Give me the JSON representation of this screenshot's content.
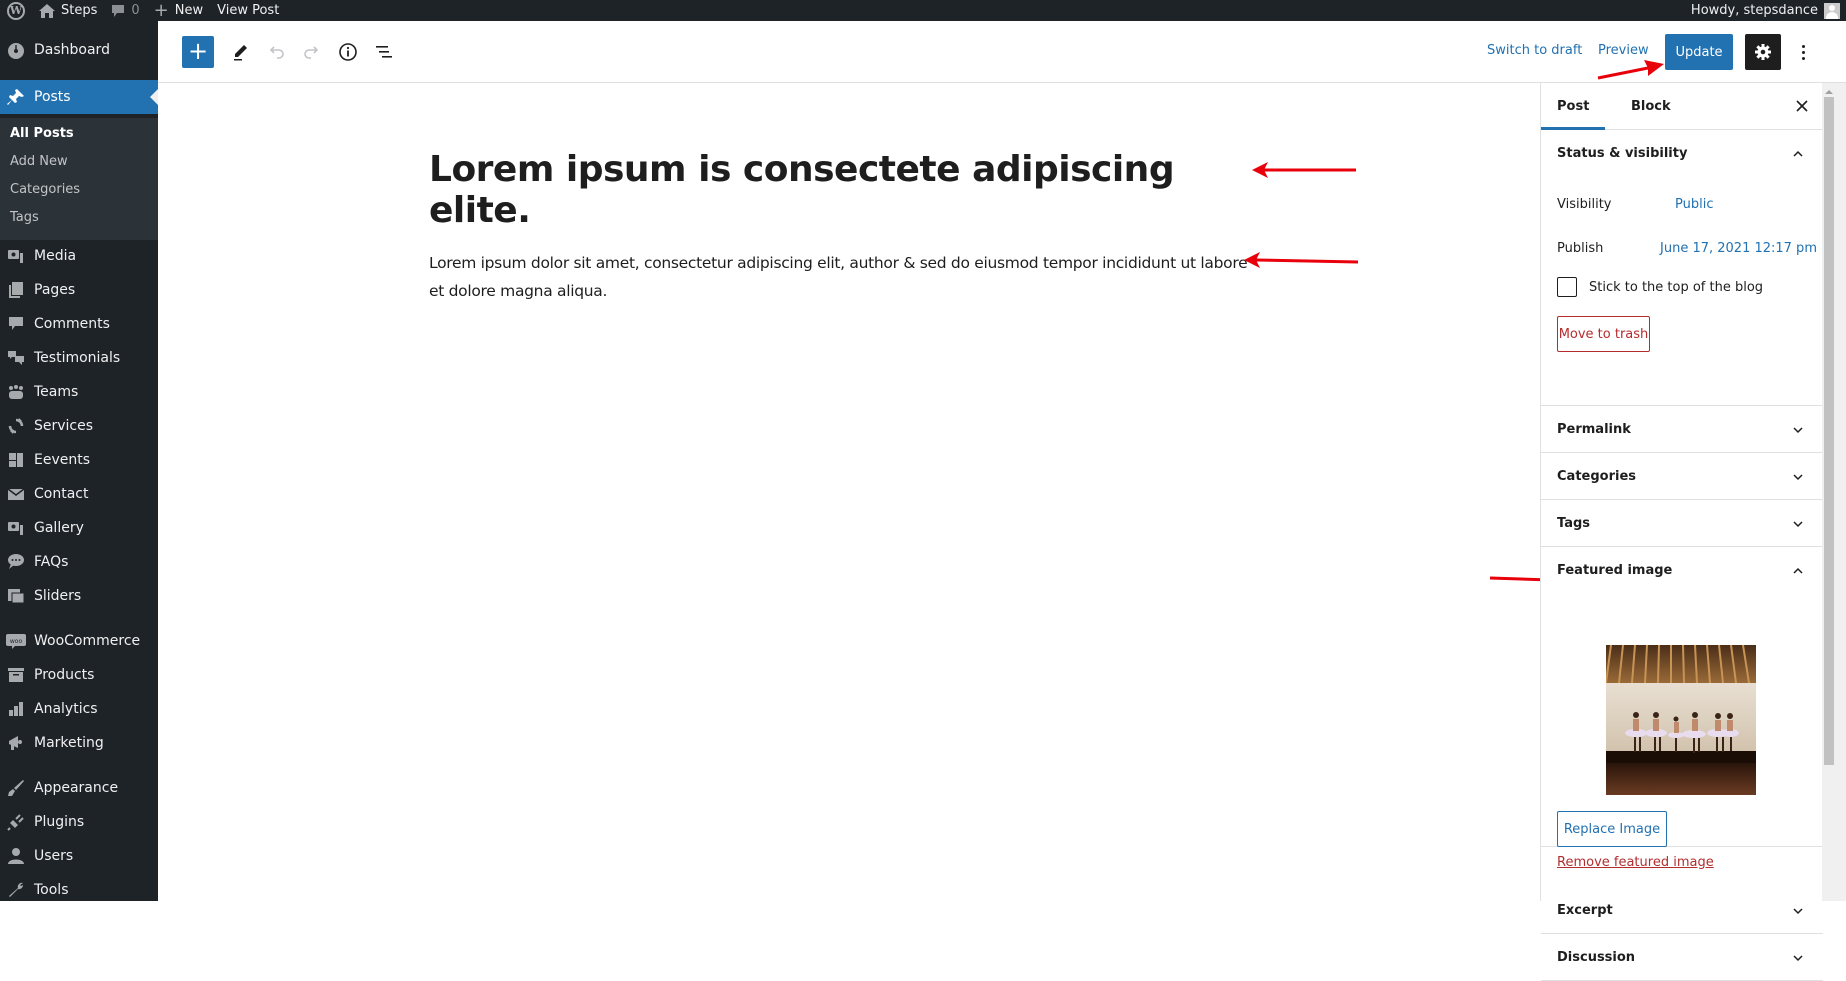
{
  "adminbar": {
    "site_name": "Steps",
    "comments_count": "0",
    "new_label": "New",
    "view_post_label": "View Post",
    "greeting": "Howdy, stepsdance"
  },
  "sidebar": {
    "items": [
      {
        "label": "Dashboard",
        "icon": "dashboard-icon"
      },
      {
        "label": "Posts",
        "icon": "pin-icon",
        "active": true
      },
      {
        "label": "Media",
        "icon": "media-icon"
      },
      {
        "label": "Pages",
        "icon": "pages-icon"
      },
      {
        "label": "Comments",
        "icon": "comment-icon"
      },
      {
        "label": "Testimonials",
        "icon": "testimonial-icon"
      },
      {
        "label": "Teams",
        "icon": "groups-icon"
      },
      {
        "label": "Services",
        "icon": "update-icon"
      },
      {
        "label": "Eevents",
        "icon": "layout-icon"
      },
      {
        "label": "Contact",
        "icon": "email-icon"
      },
      {
        "label": "Gallery",
        "icon": "media-icon"
      },
      {
        "label": "FAQs",
        "icon": "format-chat-icon"
      },
      {
        "label": "Sliders",
        "icon": "slides-icon"
      },
      {
        "label": "WooCommerce",
        "icon": "woo-icon"
      },
      {
        "label": "Products",
        "icon": "archive-icon"
      },
      {
        "label": "Analytics",
        "icon": "chart-bar-icon"
      },
      {
        "label": "Marketing",
        "icon": "megaphone-icon"
      },
      {
        "label": "Appearance",
        "icon": "brush-icon"
      },
      {
        "label": "Plugins",
        "icon": "plugin-icon"
      },
      {
        "label": "Users",
        "icon": "user-icon"
      },
      {
        "label": "Tools",
        "icon": "wrench-icon"
      }
    ],
    "submenu": [
      {
        "label": "All Posts",
        "current": true
      },
      {
        "label": "Add New"
      },
      {
        "label": "Categories"
      },
      {
        "label": "Tags"
      }
    ]
  },
  "header": {
    "switch_to_draft": "Switch to draft",
    "preview": "Preview",
    "update": "Update"
  },
  "post": {
    "title": "Lorem ipsum is consectete adipiscing elite.",
    "body": "Lorem ipsum dolor sit amet, consectetur adipiscing elit, author & sed do eiusmod tempor incididunt ut labore et dolore magna aliqua."
  },
  "settings": {
    "tabs": [
      "Post",
      "Block"
    ],
    "status_visibility": {
      "title": "Status & visibility",
      "visibility_label": "Visibility",
      "visibility_value": "Public",
      "publish_label": "Publish",
      "publish_value": "June 17, 2021 12:17 pm",
      "sticky_label": "Stick to the top of the blog",
      "sticky_checked": false,
      "trash_label": "Move to trash"
    },
    "panels": {
      "permalink": "Permalink",
      "categories": "Categories",
      "tags": "Tags",
      "featured_image": "Featured image",
      "excerpt": "Excerpt",
      "discussion": "Discussion"
    },
    "featured_image": {
      "alt": "Ballet dancers in tutus on a studio stage",
      "replace_label": "Replace Image",
      "remove_label": "Remove featured image"
    }
  },
  "colors": {
    "accent": "#2271b1",
    "admin_dark": "#1d2327",
    "danger": "#b32d2e",
    "annotation_arrow": "#e8000b"
  }
}
